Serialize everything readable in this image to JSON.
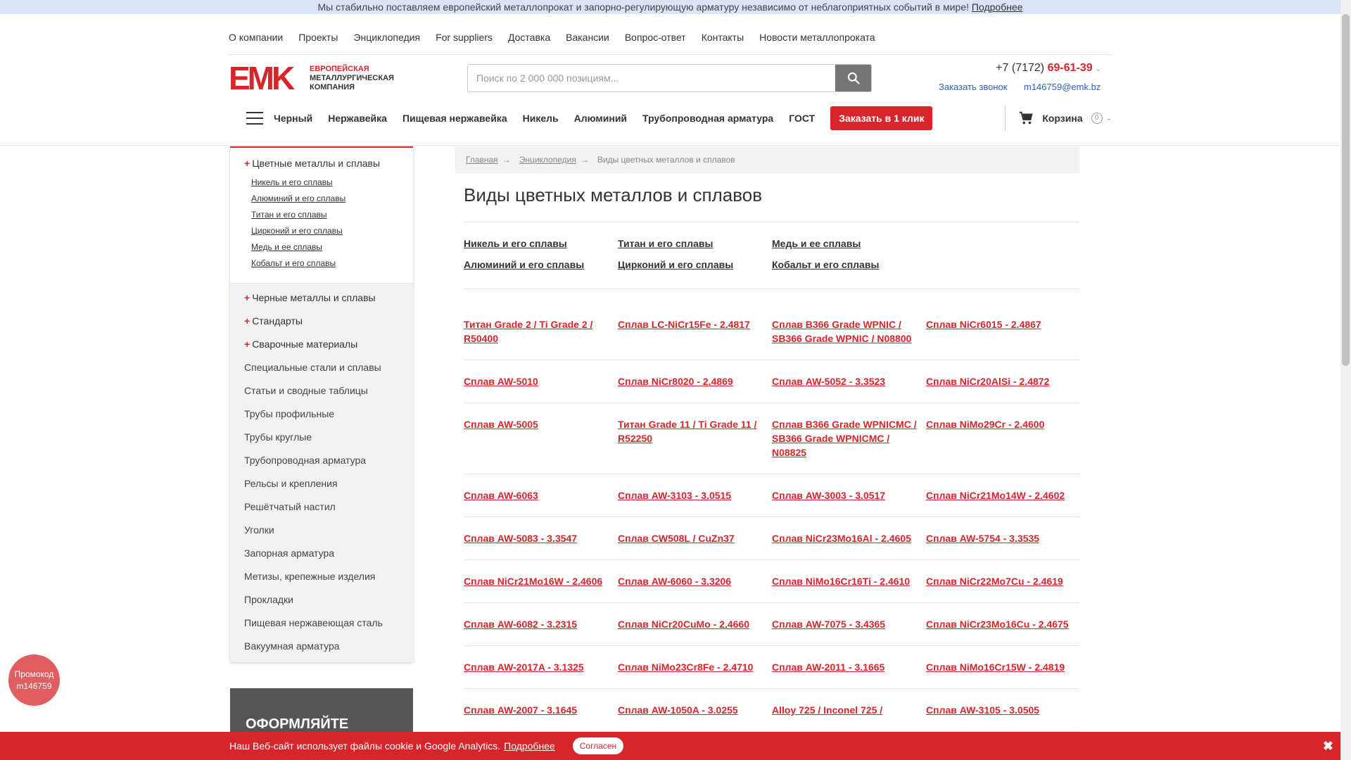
{
  "notice": {
    "text": "Мы стабильно поставляем европейский металлопрокат и запорно-регулирующую арматуру независимо от неблагоприятных событий в мире!",
    "link": "Подробнее"
  },
  "topnav": [
    "О компании",
    "Проекты",
    "Энциклопедия",
    "For suppliers",
    "Доставка",
    "Вакансии",
    "Вопрос-ответ",
    "Контакты",
    "Новости металлопроката"
  ],
  "logo": {
    "mark": "EMK",
    "line1": "ЕВРОПЕЙСКАЯ",
    "line2": "МЕТАЛЛУРГИЧЕСКАЯ",
    "line3": "КОМПАНИЯ"
  },
  "search": {
    "placeholder": "Поиск по 2 000 000 позициям..."
  },
  "contacts": {
    "phone_prefix": "+7 (7172)",
    "phone_number": "69-61-39",
    "callback": "Заказать звонок",
    "email": "m146759@emk.bz"
  },
  "catnav": {
    "items": [
      "Черный",
      "Нержавейка",
      "Пищевая нержавейка",
      "Никель",
      "Алюминий",
      "Трубопроводная арматура",
      "ГОСТ"
    ],
    "one_click": "Заказать в 1 клик",
    "cart": "Корзина",
    "cart_count": "0"
  },
  "sidebar": {
    "open_title": "Цветные металлы и сплавы",
    "sub": [
      "Никель и его сплавы",
      "Алюминий и его сплавы",
      "Титан и его сплавы",
      "Цирконий и его сплавы",
      "Медь и ее сплавы",
      "Кобальт и его сплавы"
    ],
    "plus_items": [
      "Черные металлы и сплавы",
      "Стандарты",
      "Сварочные материалы"
    ],
    "items": [
      "Специальные стали и сплавы",
      "Статьи и сводные таблицы",
      "Трубы профильные",
      "Трубы круглые",
      "Трубопроводная арматура",
      "Рельсы и крепления",
      "Решётчатый настил",
      "Уголки",
      "Запорная арматура",
      "Метизы, крепежные изделия",
      "Прокладки",
      "Пищевая нержавеющая сталь",
      "Вакуумная арматура"
    ]
  },
  "promo_box": "ОФОРМЛЯЙТЕ",
  "promo_badge": {
    "line1": "Промокод",
    "line2": "m146759"
  },
  "breadcrumb": [
    "Главная",
    "Энциклопедия",
    "Виды цветных металлов и сплавов"
  ],
  "page_title": "Виды цветных металлов и сплавов",
  "subcats": [
    "Никель и его сплавы",
    "Титан и его сплавы",
    "Медь и ее сплавы",
    "",
    "Алюминий и его сплавы",
    "Цирконий и его сплавы",
    "Кобальт и его сплавы",
    ""
  ],
  "alloy_rows": [
    [
      "Титан Grade 2 / Ti Grade 2 / R50400",
      "Сплав LC-NiCr15Fe - 2.4817",
      "Сплав B366 Grade WPNIC / SB366 Grade WPNIC / N08800",
      "Сплав NiCr6015 - 2.4867"
    ],
    [
      "Сплав AW-5010",
      "Сплав NiCr8020 - 2.4869",
      "Сплав AW-5052 - 3.3523",
      "Сплав NiCr20AlSi - 2.4872"
    ],
    [
      "Сплав AW-5005",
      "Титан Grade 11 / Ti Grade 11 / R52250",
      "Сплав B366 Grade WPNICMC / SB366 Grade WPNICMC / N08825",
      "Сплав NiMo29Cr - 2.4600"
    ],
    [
      "Сплав AW-6063",
      "Сплав AW-3103 - 3.0515",
      "Сплав AW-3003 - 3.0517",
      "Сплав NiCr21Mo14W - 2.4602"
    ],
    [
      "Сплав AW-5083 - 3.3547",
      "Сплав CW508L / CuZn37",
      "Сплав NiCr23Mo16Al - 2.4605",
      "Сплав AW-5754 - 3.3535"
    ],
    [
      "Сплав NiCr21Mo16W - 2.4606",
      "Сплав AW-6060 - 3.3206",
      "Сплав NiMo16Cr16Ti - 2.4610",
      "Сплав NiCr22Mo7Cu - 2.4619"
    ],
    [
      "Сплав AW-6082 - 3.2315",
      "Сплав NiCr20CuMo - 2.4660",
      "Сплав AW-7075 - 3.4365",
      "Сплав NiCr23Mo16Cu - 2.4675"
    ],
    [
      "Сплав AW-2017A - 3.1325",
      "Сплав NiMo23Cr8Fe - 2.4710",
      "Сплав AW-2011 - 3.1665",
      "Сплав NiMo16Cr15W - 2.4819"
    ],
    [
      "Сплав AW-2007 - 3.1645",
      "Сплав AW-1050A - 3.0255",
      "Alloy 725 / Inconel 725 /",
      "Сплав AW-3105 - 3.0505"
    ]
  ],
  "cookie": {
    "text": "Наш Веб-сайт использует файлы cookie и Google Analytics.",
    "link": "Подробнее",
    "button": "Согласен",
    "close": "✖"
  },
  "colors": {
    "accent": "#d6262b",
    "link_blue": "#2b64c4",
    "notice_bg": "#dbe3f6"
  }
}
